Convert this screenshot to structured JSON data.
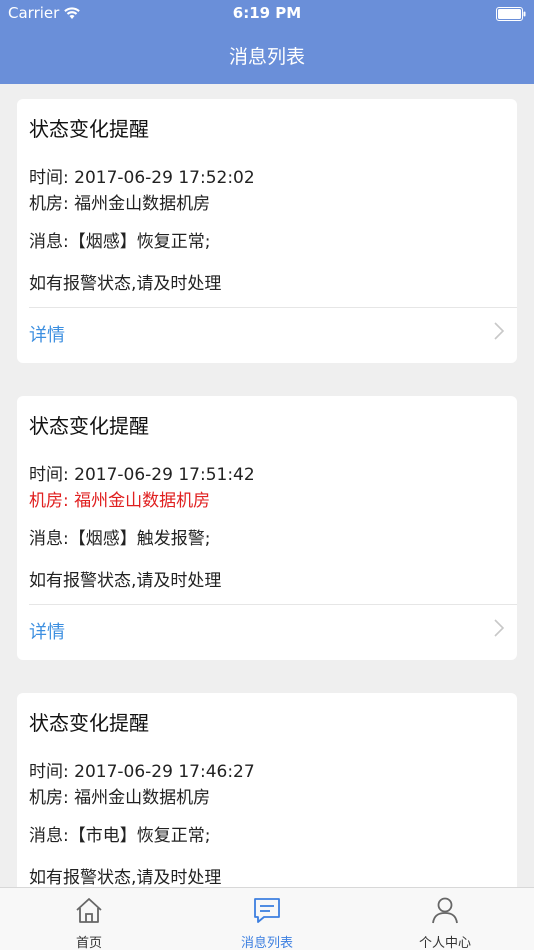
{
  "status_bar": {
    "carrier": "Carrier",
    "time": "6:19 PM"
  },
  "nav": {
    "title": "消息列表"
  },
  "messages": [
    {
      "title": "状态变化提醒",
      "time_label": "时间:",
      "time_value": "2017-06-29 17:52:02",
      "room_label": "机房:",
      "room_value": "福州金山数据机房",
      "msg_label": "消息:",
      "msg_value": "【烟感】恢复正常;",
      "notice": "如有报警状态,请及时处理",
      "detail": "详情",
      "room_highlight": false
    },
    {
      "title": "状态变化提醒",
      "time_label": "时间:",
      "time_value": "2017-06-29 17:51:42",
      "room_label": "机房:",
      "room_value": "福州金山数据机房",
      "msg_label": "消息:",
      "msg_value": "【烟感】触发报警;",
      "notice": "如有报警状态,请及时处理",
      "detail": "详情",
      "room_highlight": true
    },
    {
      "title": "状态变化提醒",
      "time_label": "时间:",
      "time_value": "2017-06-29 17:46:27",
      "room_label": "机房:",
      "room_value": "福州金山数据机房",
      "msg_label": "消息:",
      "msg_value": "【市电】恢复正常;",
      "notice": "如有报警状态,请及时处理",
      "detail": "详情",
      "room_highlight": false
    }
  ],
  "tabs": [
    {
      "label": "首页",
      "icon": "home-icon",
      "active": false
    },
    {
      "label": "消息列表",
      "icon": "message-icon",
      "active": true
    },
    {
      "label": "个人中心",
      "icon": "user-icon",
      "active": false
    }
  ],
  "colors": {
    "nav_bg": "#6a8fd9",
    "link": "#3d8fe0",
    "alert_red": "#e02020",
    "tab_active": "#3d7fe0"
  }
}
